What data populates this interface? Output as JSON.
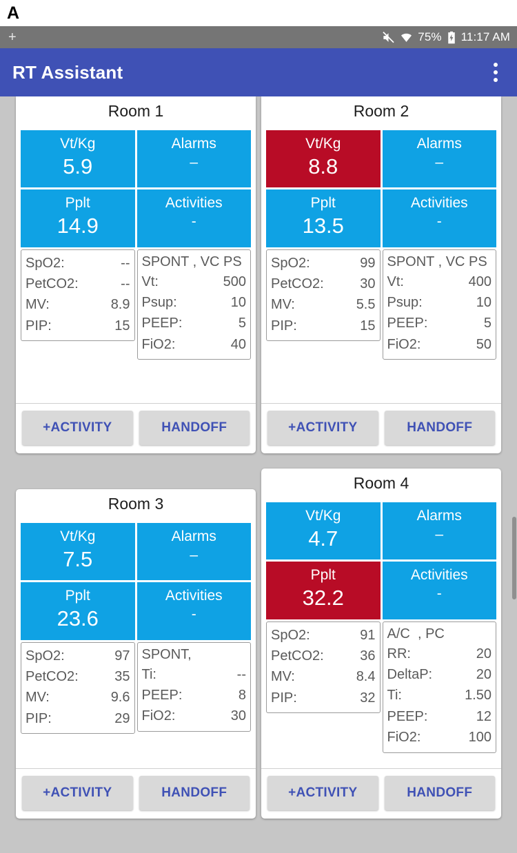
{
  "panel": {
    "letter": "A"
  },
  "status_bar": {
    "left_icon": "add-icon",
    "mute_icon": "mute-icon",
    "wifi_icon": "wifi-icon",
    "battery_percent": "75%",
    "battery_icon": "battery-charging-icon",
    "time": "11:17 AM"
  },
  "app_bar": {
    "title": "RT Assistant",
    "overflow_icon": "more-vert-icon",
    "color": "#3f51b5"
  },
  "colors": {
    "tile_normal": "#0fa2e4",
    "tile_alert": "#b80c26",
    "background": "#c6c6c6",
    "button_text": "#3f51b5"
  },
  "buttons": {
    "activity": "+ACTIVITY",
    "handoff": "HANDOFF"
  },
  "rooms": [
    {
      "title": "Room 1",
      "tiles": [
        {
          "label": "Vt/Kg",
          "value": "5.9",
          "alert": false
        },
        {
          "label": "Alarms",
          "value": "–",
          "alert": false
        },
        {
          "label": "Pplt",
          "value": "14.9",
          "alert": false
        },
        {
          "label": "Activities",
          "value": "-",
          "alert": false
        }
      ],
      "vitals": [
        {
          "label": "SpO2:",
          "value": "--"
        },
        {
          "label": "PetCO2:",
          "value": "--"
        },
        {
          "label": "MV:",
          "value": "8.9"
        },
        {
          "label": "PIP:",
          "value": "15"
        }
      ],
      "mode": "SPONT , VC PS",
      "settings": [
        {
          "label": "Vt:",
          "value": "500"
        },
        {
          "label": "Psup:",
          "value": "10"
        },
        {
          "label": "PEEP:",
          "value": "5"
        },
        {
          "label": "FiO2:",
          "value": "40"
        }
      ]
    },
    {
      "title": "Room 2",
      "tiles": [
        {
          "label": "Vt/Kg",
          "value": "8.8",
          "alert": true
        },
        {
          "label": "Alarms",
          "value": "–",
          "alert": false
        },
        {
          "label": "Pplt",
          "value": "13.5",
          "alert": false
        },
        {
          "label": "Activities",
          "value": "-",
          "alert": false
        }
      ],
      "vitals": [
        {
          "label": "SpO2:",
          "value": "99"
        },
        {
          "label": "PetCO2:",
          "value": "30"
        },
        {
          "label": "MV:",
          "value": "5.5"
        },
        {
          "label": "PIP:",
          "value": "15"
        }
      ],
      "mode": "SPONT , VC PS",
      "settings": [
        {
          "label": "Vt:",
          "value": "400"
        },
        {
          "label": "Psup:",
          "value": "10"
        },
        {
          "label": "PEEP:",
          "value": "5"
        },
        {
          "label": "FiO2:",
          "value": "50"
        }
      ]
    },
    {
      "title": "Room 3",
      "tiles": [
        {
          "label": "Vt/Kg",
          "value": "7.5",
          "alert": false
        },
        {
          "label": "Alarms",
          "value": "–",
          "alert": false
        },
        {
          "label": "Pplt",
          "value": "23.6",
          "alert": false
        },
        {
          "label": "Activities",
          "value": "-",
          "alert": false
        }
      ],
      "vitals": [
        {
          "label": "SpO2:",
          "value": "97"
        },
        {
          "label": "PetCO2:",
          "value": "35"
        },
        {
          "label": "MV:",
          "value": "9.6"
        },
        {
          "label": "PIP:",
          "value": "29"
        }
      ],
      "mode": "SPONT,",
      "settings": [
        {
          "label": "Ti:",
          "value": "--"
        },
        {
          "label": "PEEP:",
          "value": "8"
        },
        {
          "label": "FiO2:",
          "value": "30"
        }
      ]
    },
    {
      "title": "Room 4",
      "tiles": [
        {
          "label": "Vt/Kg",
          "value": "4.7",
          "alert": false
        },
        {
          "label": "Alarms",
          "value": "–",
          "alert": false
        },
        {
          "label": "Pplt",
          "value": "32.2",
          "alert": true
        },
        {
          "label": "Activities",
          "value": "-",
          "alert": false
        }
      ],
      "vitals": [
        {
          "label": "SpO2:",
          "value": "91"
        },
        {
          "label": "PetCO2:",
          "value": "36"
        },
        {
          "label": "MV:",
          "value": "8.4"
        },
        {
          "label": "PIP:",
          "value": "32"
        }
      ],
      "mode": "A/C  , PC",
      "settings": [
        {
          "label": "RR:",
          "value": "20"
        },
        {
          "label": "DeltaP:",
          "value": "20"
        },
        {
          "label": "Ti:",
          "value": "1.50"
        },
        {
          "label": "PEEP:",
          "value": "12"
        },
        {
          "label": "FiO2:",
          "value": "100"
        }
      ]
    }
  ]
}
